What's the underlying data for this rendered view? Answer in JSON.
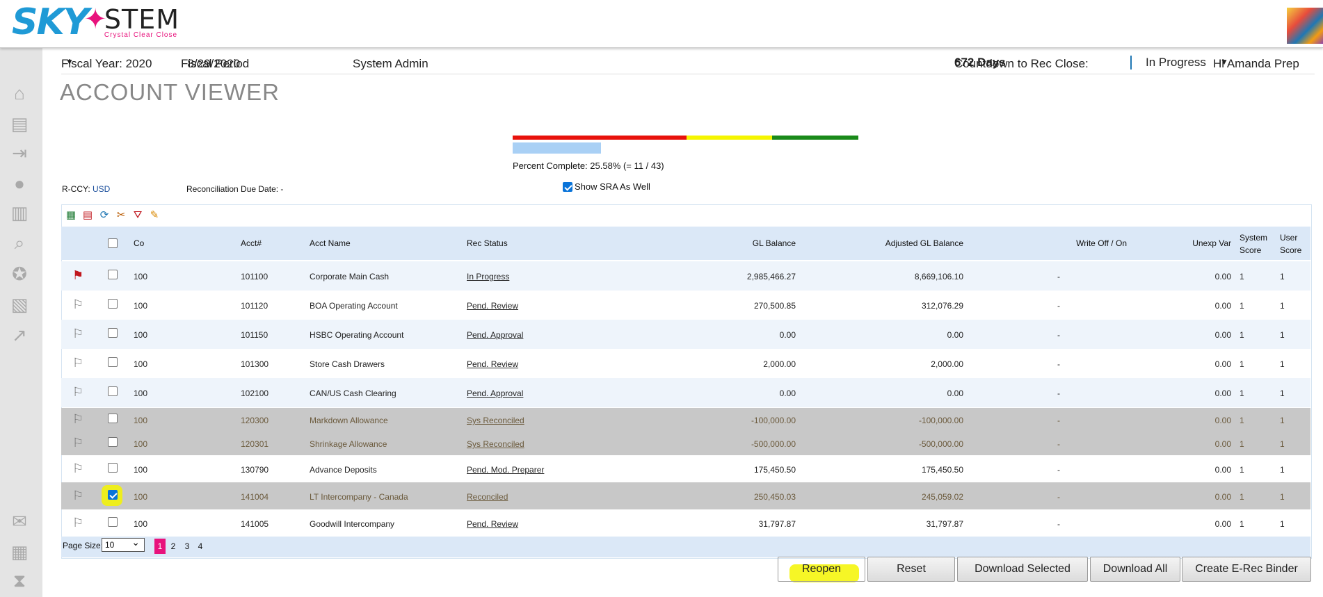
{
  "app": {
    "logo_text_1": "SKY",
    "logo_text_2": "STEM",
    "logo_tagline": "Crystal Clear Close"
  },
  "nav": {
    "fiscal_year": "Fiscal Year: 2020",
    "fiscal_period_label": "Fiscal Period",
    "fiscal_period_value": "8/29/2020",
    "role": "System Admin",
    "countdown_label": "Countdown to Rec Close:",
    "countdown_value": "672 Days",
    "status": "In Progress",
    "user": "Hi Amanda Prep"
  },
  "page": {
    "title": "ACCOUNT VIEWER"
  },
  "progress": {
    "text": "Percent Complete: 25.58% (= 11 / 43)",
    "fraction": 0.2558,
    "colors": [
      "#e8120c",
      "#f5f500",
      "#1a8a1a"
    ]
  },
  "filters": {
    "rccy_label": "R-CCY:",
    "rccy_value": "USD",
    "due_date": "Reconciliation Due Date: -",
    "show_sra": "Show SRA As Well",
    "show_sra_checked": true
  },
  "table": {
    "headers": {
      "co": "Co",
      "acct": "Acct#",
      "name": "Acct Name",
      "status": "Rec Status",
      "gl": "GL Balance",
      "adj": "Adjusted GL Balance",
      "wo": "Write Off / On",
      "unexp": "Unexp Var",
      "sys1": "System",
      "sys2": "Score",
      "usr1": "User",
      "usr2": "Score"
    },
    "rows": [
      {
        "flag": "red",
        "checked": false,
        "co": "100",
        "acct": "101100",
        "name": "Corporate Main Cash",
        "status": "In Progress",
        "gl": "2,985,466.27",
        "adj": "8,669,106.10",
        "wo": "-",
        "unexp": "0.00",
        "sys": "1",
        "usr": "1",
        "style": "alt"
      },
      {
        "flag": "white",
        "checked": false,
        "co": "100",
        "acct": "101120",
        "name": "BOA Operating Account",
        "status": "Pend. Review",
        "gl": "270,500.85",
        "adj": "312,076.29",
        "wo": "-",
        "unexp": "0.00",
        "sys": "1",
        "usr": "1",
        "style": "plain"
      },
      {
        "flag": "white",
        "checked": false,
        "co": "100",
        "acct": "101150",
        "name": "HSBC Operating Account",
        "status": "Pend. Approval",
        "gl": "0.00",
        "adj": "0.00",
        "wo": "-",
        "unexp": "0.00",
        "sys": "1",
        "usr": "1",
        "style": "alt"
      },
      {
        "flag": "white",
        "checked": false,
        "co": "100",
        "acct": "101300",
        "name": "Store Cash Drawers",
        "status": "Pend. Review",
        "gl": "2,000.00",
        "adj": "2,000.00",
        "wo": "-",
        "unexp": "0.00",
        "sys": "1",
        "usr": "1",
        "style": "plain"
      },
      {
        "flag": "white",
        "checked": false,
        "co": "100",
        "acct": "102100",
        "name": "CAN/US Cash Clearing",
        "status": "Pend. Approval",
        "gl": "0.00",
        "adj": "0.00",
        "wo": "-",
        "unexp": "0.00",
        "sys": "1",
        "usr": "1",
        "style": "alt"
      },
      {
        "flag": "white",
        "checked": false,
        "co": "100",
        "acct": "120300",
        "name": "Markdown Allowance",
        "status": "Sys Reconciled",
        "gl": "-100,000.00",
        "adj": "-100,000.00",
        "wo": "-",
        "unexp": "0.00",
        "sys": "1",
        "usr": "1",
        "style": "gray"
      },
      {
        "flag": "white",
        "checked": false,
        "co": "100",
        "acct": "120301",
        "name": "Shrinkage Allowance",
        "status": "Sys Reconciled",
        "gl": "-500,000.00",
        "adj": "-500,000.00",
        "wo": "-",
        "unexp": "0.00",
        "sys": "1",
        "usr": "1",
        "style": "gray"
      },
      {
        "flag": "white",
        "checked": false,
        "co": "100",
        "acct": "130790",
        "name": "Advance Deposits",
        "status": "Pend. Mod. Preparer",
        "gl": "175,450.50",
        "adj": "175,450.50",
        "wo": "-",
        "unexp": "0.00",
        "sys": "1",
        "usr": "1",
        "style": "plain"
      },
      {
        "flag": "white",
        "checked": true,
        "co": "100",
        "acct": "141004",
        "name": "LT Intercompany - Canada",
        "status": "Reconciled",
        "gl": "250,450.03",
        "adj": "245,059.02",
        "wo": "-",
        "unexp": "0.00",
        "sys": "1",
        "usr": "1",
        "style": "gray"
      },
      {
        "flag": "white",
        "checked": false,
        "co": "100",
        "acct": "141005",
        "name": "Goodwill Intercompany",
        "status": "Pend. Review",
        "gl": "31,797.87",
        "adj": "31,797.87",
        "wo": "-",
        "unexp": "0.00",
        "sys": "1",
        "usr": "1",
        "style": "plain"
      }
    ]
  },
  "pager": {
    "label": "Page Size:",
    "size": "10",
    "pages": [
      "1",
      "2",
      "3",
      "4"
    ],
    "current": "1"
  },
  "buttons": {
    "reopen": "Reopen",
    "reset": "Reset",
    "download_selected": "Download Selected",
    "download_all": "Download All",
    "create_binder": "Create E-Rec Binder"
  }
}
